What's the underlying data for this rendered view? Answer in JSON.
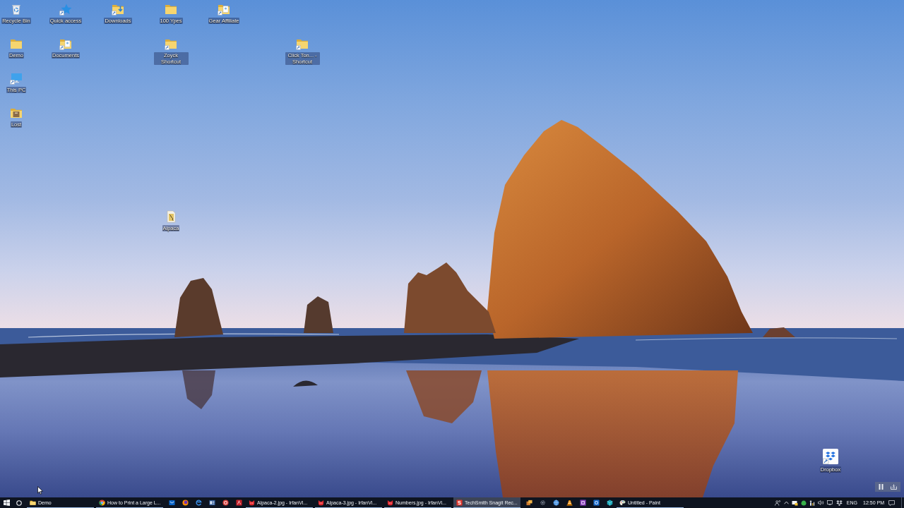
{
  "desktop": {
    "icons": [
      {
        "kind": "recycle_bin",
        "label": "Recycle Bin",
        "shortcut": false
      },
      {
        "kind": "star",
        "label": "Quick access",
        "shortcut": true
      },
      {
        "kind": "download_folder",
        "label": "Downloads",
        "shortcut": true
      },
      {
        "kind": "folder",
        "label": "100 Ypes",
        "shortcut": false
      },
      {
        "kind": "document_folder",
        "label": "Gear Affiliate",
        "shortcut": true
      },
      {
        "kind": "folder",
        "label": "Demo",
        "shortcut": false
      },
      {
        "kind": "document_folder",
        "label": "Documents",
        "shortcut": true
      },
      {
        "kind": "folder",
        "label": "Zoyck Shortcut",
        "shortcut": true
      },
      {
        "kind": "folder",
        "label": "Click Ton... - Shortcut",
        "shortcut": true
      },
      {
        "kind": "computer",
        "label": "This PC",
        "shortcut": true
      },
      {
        "kind": "archive",
        "label": "Lost",
        "shortcut": false
      },
      {
        "kind": "image",
        "label": "Alpaca",
        "shortcut": false
      },
      {
        "kind": "app",
        "label": "Dropbox",
        "shortcut": true
      }
    ]
  },
  "taskbar": {
    "items": [
      {
        "kind": "folder",
        "label": "Demo",
        "open": true,
        "active": false
      },
      {
        "kind": "browser",
        "label": "How to Print a Large L...",
        "open": true,
        "active": false
      },
      {
        "kind": "mail",
        "open": false,
        "active": false
      },
      {
        "kind": "orb",
        "open": false,
        "active": false
      },
      {
        "kind": "swirl",
        "open": false,
        "active": false
      },
      {
        "kind": "word",
        "open": false,
        "active": false
      },
      {
        "kind": "disc",
        "open": false,
        "active": false
      },
      {
        "kind": "pdf",
        "open": false,
        "active": false
      },
      {
        "kind": "viewer",
        "label": "Alpaca-2.jpg - IrfanVi...",
        "open": true,
        "active": false
      },
      {
        "kind": "viewer",
        "label": "Alpaca-3.jpg - IrfanVi...",
        "open": true,
        "active": false
      },
      {
        "kind": "viewer",
        "label": "Numbers.jpg - IrfanVi...",
        "open": true,
        "active": false
      },
      {
        "kind": "capture",
        "label": "TechSmith Snagit Rec...",
        "open": true,
        "active": true
      },
      {
        "kind": "stack",
        "open": false,
        "active": false
      },
      {
        "kind": "gear",
        "open": false,
        "active": false
      },
      {
        "kind": "globe",
        "open": false,
        "active": false
      },
      {
        "kind": "cone",
        "open": false,
        "active": false
      },
      {
        "kind": "note",
        "open": false,
        "active": false
      },
      {
        "kind": "lens",
        "open": false,
        "active": false
      },
      {
        "kind": "cube",
        "open": false,
        "active": false
      },
      {
        "kind": "paint",
        "label": "Untitled - Paint",
        "open": true,
        "active": false
      }
    ],
    "tray": {
      "language": "ENG",
      "clock": "12:50 PM"
    }
  }
}
